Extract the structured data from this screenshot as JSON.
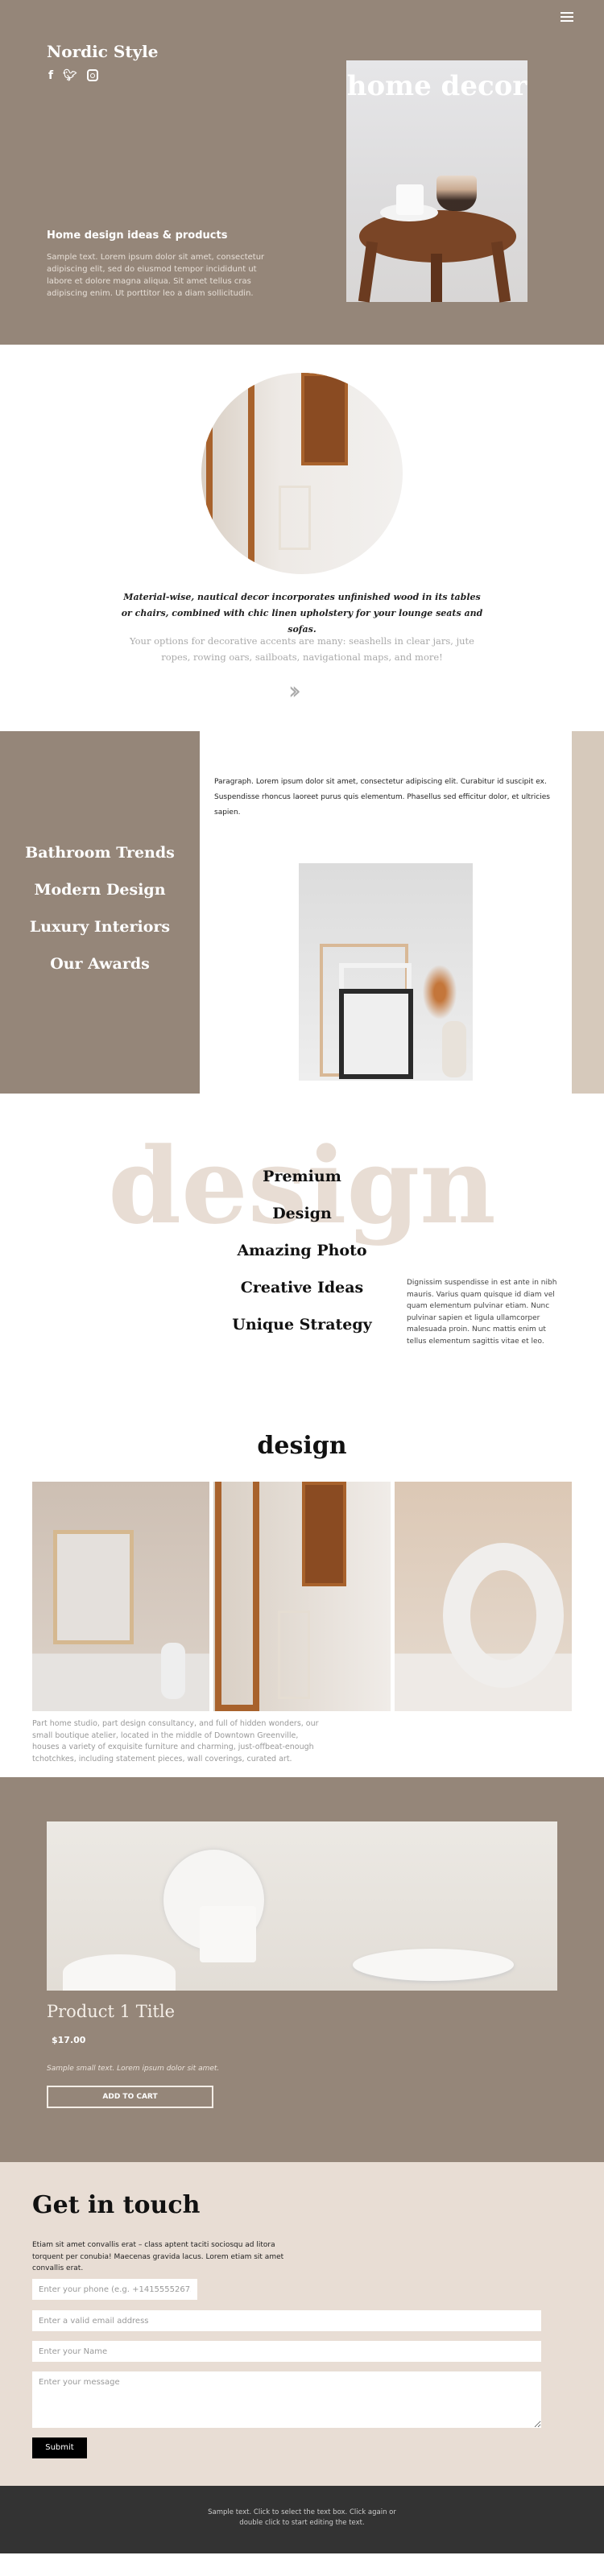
{
  "colors": {
    "brand": "#958679",
    "light": "#e8ddd4",
    "accent": "#d6c9bb",
    "footer": "#333333"
  },
  "hero": {
    "title": "Nordic Style",
    "social": [
      "facebook-icon",
      "twitter-icon",
      "instagram-icon"
    ],
    "subtitle": "Home design ideas & products",
    "text": "Sample text. Lorem ipsum dolor sit amet, consectetur adipiscing elit, sed do eiusmod tempor incididunt ut labore et dolore magna aliqua. Sit amet tellus cras adipiscing enim. Ut porttitor leo a diam sollicitudin.",
    "image_caption": "home decor",
    "menu_icon": "hamburger-icon"
  },
  "intro": {
    "quote": "Material-wise, nautical decor incorporates unfinished wood in its tables or chairs, combined with chic linen upholstery for your lounge seats and sofas.",
    "text": "Your options for decorative accents are many: seashells in clear jars, jute ropes, rowing oars, sailboats, navigational maps, and more!",
    "chevron_icon": "double-chevron-right-icon"
  },
  "categories": {
    "items": [
      "Bathroom Trends",
      "Modern Design",
      "Luxury Interiors",
      "Our Awards"
    ],
    "paragraph": "Paragraph. Lorem ipsum dolor sit amet, consectetur adipiscing elit. Curabitur id suscipit ex. Suspendisse rhoncus laoreet purus quis elementum. Phasellus sed efficitur dolor, et ultricies sapien."
  },
  "features": {
    "watermark": "design",
    "items": [
      "Premium",
      "Design",
      "Amazing Photo",
      "Creative Ideas",
      "Unique Strategy"
    ],
    "text": "Dignissim suspendisse in est ante in nibh mauris. Varius quam quisque id diam vel quam elementum pulvinar etiam. Nunc pulvinar sapien et ligula ullamcorper malesuada proin. Nunc mattis enim ut tellus elementum sagittis vitae et leo."
  },
  "gallery": {
    "title": "design",
    "text": "Part home studio, part design consultancy, and full of hidden wonders, our small boutique atelier, located in the middle of Downtown Greenville, houses a variety of exquisite furniture and charming, just-offbeat-enough tchotchkes, including statement pieces, wall coverings, curated art."
  },
  "product": {
    "title": "Product 1 Title",
    "price": "$17.00",
    "text": "Sample small text. Lorem ipsum dolor sit amet.",
    "button": "ADD TO CART"
  },
  "contact": {
    "title": "Get in touch",
    "text": "Etiam sit amet convallis erat – class aptent taciti sociosqu ad litora torquent per conubia! Maecenas gravida lacus. Lorem etiam sit amet convallis erat.",
    "phone_placeholder": "Enter your phone (e.g. +14155552675)",
    "email_placeholder": "Enter a valid email address",
    "name_placeholder": "Enter your Name",
    "message_placeholder": "Enter your message",
    "submit": "Submit"
  },
  "footer": {
    "text": "Sample text. Click to select the text box. Click again or double click to start editing the text."
  }
}
